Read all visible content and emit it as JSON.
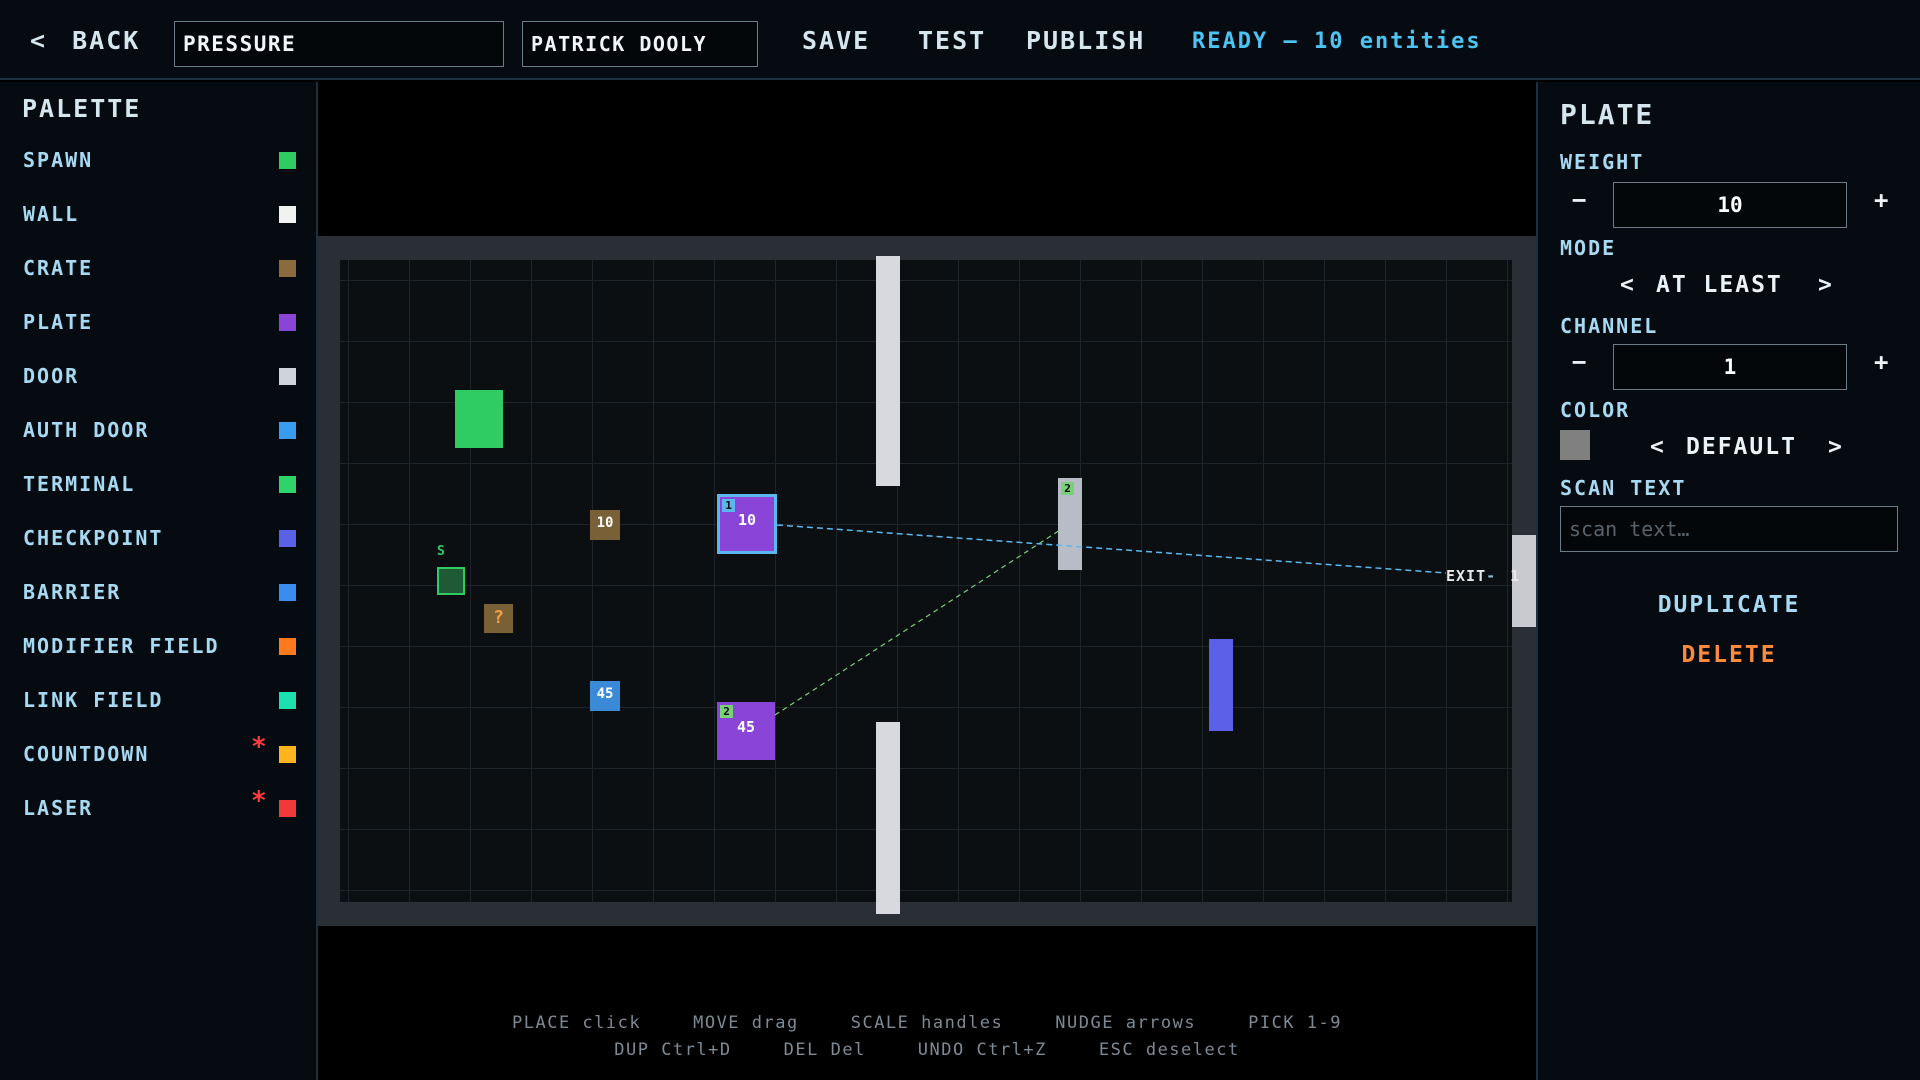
{
  "topbar": {
    "back_arrow": "<",
    "back_label": "BACK",
    "level_name": "PRESSURE",
    "author": "PATRICK DOOLY",
    "save": "SAVE",
    "test": "TEST",
    "publish": "PUBLISH",
    "status": "READY — 10 entities"
  },
  "palette": {
    "title": "PALETTE",
    "items": [
      {
        "label": "SPAWN",
        "color": "#2ecc63",
        "star": ""
      },
      {
        "label": "WALL",
        "color": "#f2f2f2",
        "star": ""
      },
      {
        "label": "CRATE",
        "color": "#8b6b3d",
        "star": ""
      },
      {
        "label": "PLATE",
        "color": "#8a44d8",
        "star": ""
      },
      {
        "label": "DOOR",
        "color": "#cfd3da",
        "star": ""
      },
      {
        "label": "AUTH DOOR",
        "color": "#3a9cf0",
        "star": ""
      },
      {
        "label": "TERMINAL",
        "color": "#2ed36a",
        "star": ""
      },
      {
        "label": "CHECKPOINT",
        "color": "#5a60e8",
        "star": ""
      },
      {
        "label": "BARRIER",
        "color": "#3a8cf0",
        "star": ""
      },
      {
        "label": "MODIFIER FIELD",
        "color": "#ff7a1c",
        "star": ""
      },
      {
        "label": "LINK FIELD",
        "color": "#1de0b0",
        "star": ""
      },
      {
        "label": "COUNTDOWN",
        "color": "#ffb31c",
        "star": "*"
      },
      {
        "label": "LASER",
        "color": "#f03a3a",
        "star": "*"
      }
    ]
  },
  "canvas": {
    "spawn_marker": "S",
    "crate_weight_1": "10",
    "crate_mystery": "?",
    "auth_crate_weight": "45",
    "plate_1": {
      "badge": "1",
      "weight": "10"
    },
    "plate_2": {
      "badge": "2",
      "weight": "45"
    },
    "door_badge": "2",
    "exit_label": "EXIT",
    "exit_channel": "1"
  },
  "hints": {
    "row1": [
      "PLACE click",
      "MOVE drag",
      "SCALE handles",
      "NUDGE arrows",
      "PICK 1-9"
    ],
    "row2": [
      "DUP Ctrl+D",
      "DEL Del",
      "UNDO Ctrl+Z",
      "ESC deselect"
    ]
  },
  "inspector": {
    "title": "PLATE",
    "weight_label": "WEIGHT",
    "weight_value": "10",
    "mode_label": "MODE",
    "mode_value": "AT LEAST",
    "channel_label": "CHANNEL",
    "channel_value": "1",
    "color_label": "COLOR",
    "color_value": "DEFAULT",
    "color_swatch": "#808080",
    "scan_label": "SCAN TEXT",
    "scan_placeholder": "scan text…",
    "duplicate": "DUPLICATE",
    "delete": "DELETE",
    "minus": "−",
    "plus": "+",
    "prev": "<",
    "next": ">"
  }
}
